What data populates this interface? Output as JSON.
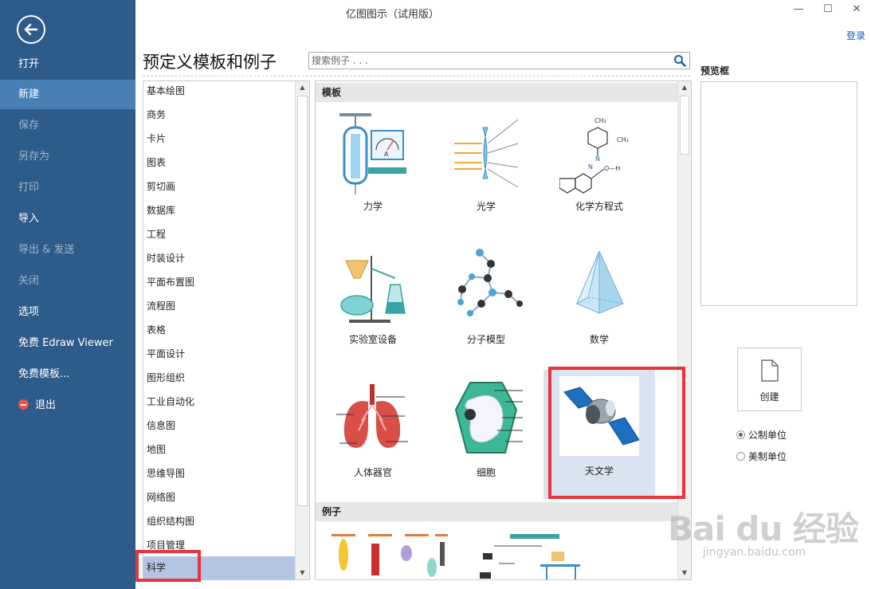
{
  "window": {
    "title": "亿图图示（试用版）",
    "minimize": "—",
    "maximize": "☐",
    "close": "✕",
    "login": "登录"
  },
  "sidebar": {
    "items": [
      {
        "label": "打开"
      },
      {
        "label": "新建"
      },
      {
        "label": "保存"
      },
      {
        "label": "另存为"
      },
      {
        "label": "打印"
      },
      {
        "label": "导入"
      },
      {
        "label": "导出 & 发送"
      },
      {
        "label": "关闭"
      },
      {
        "label": "选项"
      },
      {
        "label": "免费 Edraw Viewer"
      },
      {
        "label": "免费模板..."
      },
      {
        "label": "退出"
      }
    ]
  },
  "main": {
    "title": "预定义模板和例子",
    "search_placeholder": "搜索例子 . . ."
  },
  "categories": [
    "基本绘图",
    "商务",
    "卡片",
    "图表",
    "剪切画",
    "数据库",
    "工程",
    "时装设计",
    "平面布置图",
    "流程图",
    "表格",
    "平面设计",
    "图形组织",
    "工业自动化",
    "信息图",
    "地图",
    "思维导图",
    "网络图",
    "组织结构图",
    "项目管理",
    "科学"
  ],
  "sections": {
    "templates": "模板",
    "examples": "例子"
  },
  "templates": [
    {
      "label": "力学"
    },
    {
      "label": "光学"
    },
    {
      "label": "化学方程式"
    },
    {
      "label": "实验室设备"
    },
    {
      "label": "分子模型"
    },
    {
      "label": "数学"
    },
    {
      "label": "人体器官"
    },
    {
      "label": "细胞"
    },
    {
      "label": "天文学"
    }
  ],
  "preview": {
    "title": "预览框",
    "create": "创建",
    "unit_metric": "公制单位",
    "unit_us": "美制单位"
  },
  "watermark": {
    "logo": "Bai du 经验",
    "url": "jingyan.baidu.com"
  },
  "colors": {
    "sidebar": "#2e5c8a",
    "sidebar_active": "#4a7fb5",
    "highlight_frame": "#e8343b",
    "selection": "#b4c5e3"
  }
}
